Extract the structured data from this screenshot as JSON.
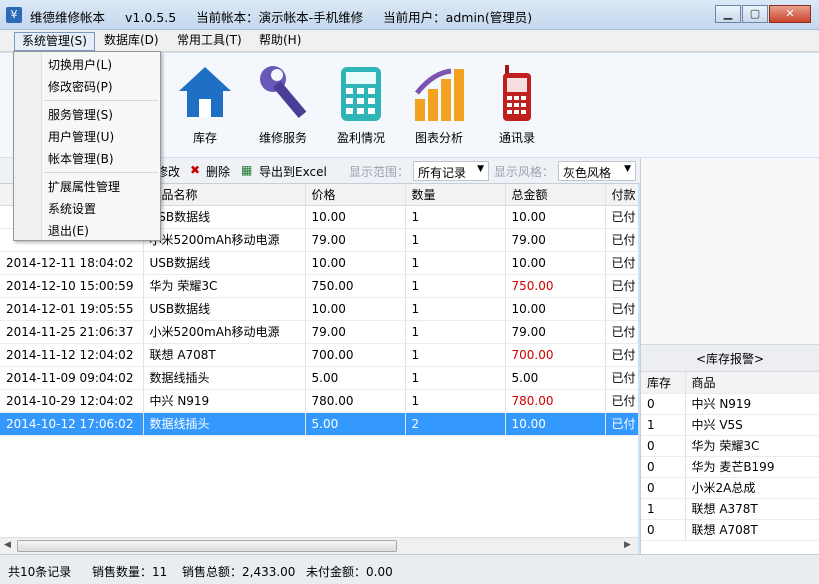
{
  "window": {
    "app_name": "维德维修帐本",
    "version": "v1.0.5.5",
    "current_book": "当前帐本：演示帐本-手机维修",
    "current_user": "当前用户：admin(管理员)"
  },
  "menubar": [
    "系统管理(S)",
    "数据库(D)",
    "常用工具(T)",
    "帮助(H)"
  ],
  "system_menu": {
    "group1": [
      "切换用户(L)",
      "修改密码(P)"
    ],
    "group2": [
      "服务管理(S)",
      "用户管理(U)",
      "帐本管理(B)"
    ],
    "group3": [
      "扩展属性管理",
      "系统设置",
      "退出(E)"
    ]
  },
  "toolbar": {
    "items": [
      "库存",
      "维修服务",
      "盈利情况",
      "图表分析",
      "通讯录"
    ]
  },
  "subbar": {
    "edit": "修改",
    "delete": "删除",
    "export": "导出到Excel",
    "range_label": "显示范围：",
    "range_value": "所有记录",
    "style_label": "显示风格：",
    "style_value": "灰色风格"
  },
  "grid": {
    "columns": [
      "",
      "商品名称",
      "价格",
      "数量",
      "总金额",
      "付款"
    ],
    "rows": [
      {
        "date": "",
        "name": "USB数据线",
        "price": "10.00",
        "qty": "1",
        "total": "10.00",
        "pay": "已付",
        "red": false
      },
      {
        "date": "",
        "name": "小米5200mAh移动电源",
        "price": "79.00",
        "qty": "1",
        "total": "79.00",
        "pay": "已付",
        "red": false
      },
      {
        "date": "2014-12-11 18:04:02",
        "name": "USB数据线",
        "price": "10.00",
        "qty": "1",
        "total": "10.00",
        "pay": "已付",
        "red": false
      },
      {
        "date": "2014-12-10 15:00:59",
        "name": "华为 荣耀3C",
        "price": "750.00",
        "qty": "1",
        "total": "750.00",
        "pay": "已付",
        "red": true
      },
      {
        "date": "2014-12-01 19:05:55",
        "name": "USB数据线",
        "price": "10.00",
        "qty": "1",
        "total": "10.00",
        "pay": "已付",
        "red": false
      },
      {
        "date": "2014-11-25 21:06:37",
        "name": "小米5200mAh移动电源",
        "price": "79.00",
        "qty": "1",
        "total": "79.00",
        "pay": "已付",
        "red": false
      },
      {
        "date": "2014-11-12 12:04:02",
        "name": "联想 A708T",
        "price": "700.00",
        "qty": "1",
        "total": "700.00",
        "pay": "已付",
        "red": true
      },
      {
        "date": "2014-11-09 09:04:02",
        "name": "数据线插头",
        "price": "5.00",
        "qty": "1",
        "total": "5.00",
        "pay": "已付",
        "red": false
      },
      {
        "date": "2014-10-29 12:04:02",
        "name": "中兴 N919",
        "price": "780.00",
        "qty": "1",
        "total": "780.00",
        "pay": "已付",
        "red": true
      },
      {
        "date": "2014-10-12 17:06:02",
        "name": "数据线插头",
        "price": "5.00",
        "qty": "2",
        "total": "10.00",
        "pay": "已付",
        "red": false,
        "selected": true
      }
    ]
  },
  "stock_alert": {
    "title": "<库存报警>",
    "columns": [
      "库存",
      "商品"
    ],
    "rows": [
      {
        "stock": "0",
        "name": "中兴 N919"
      },
      {
        "stock": "1",
        "name": "中兴 V5S"
      },
      {
        "stock": "0",
        "name": "华为 荣耀3C"
      },
      {
        "stock": "0",
        "name": "华为 麦芒B199"
      },
      {
        "stock": "0",
        "name": "小米2A总成"
      },
      {
        "stock": "1",
        "name": "联想 A378T"
      },
      {
        "stock": "0",
        "name": "联想 A708T"
      }
    ]
  },
  "status": {
    "records": "共10条记录",
    "sales_qty": "销售数量：11",
    "sales_total": "销售总额：2,433.00",
    "unpaid": "未付金额：0.00"
  },
  "colors": {
    "selection": "#3399ff",
    "highlight_red": "#d20000"
  }
}
